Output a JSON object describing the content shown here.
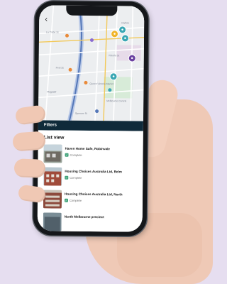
{
  "map": {
    "labels": [
      {
        "text": "La Trobe St",
        "name": "map-label-la-trobe"
      },
      {
        "text": "Victoria St",
        "name": "map-label-victoria"
      },
      {
        "text": "Peel St",
        "name": "map-label-peel"
      },
      {
        "text": "Queen Victoria Market",
        "name": "map-label-qvm"
      },
      {
        "text": "Melbourne Central",
        "name": "map-label-melb-central"
      },
      {
        "text": "Carlton",
        "name": "map-label-carlton"
      },
      {
        "text": "Flagstaff",
        "name": "map-label-flagstaff"
      },
      {
        "text": "Spencer St",
        "name": "map-label-spencer"
      }
    ],
    "pin_colors": {
      "teal": "#3aa7b3",
      "yellow": "#f0b429",
      "purple": "#6b3fa0"
    }
  },
  "panel": {
    "filters_label": "Filters",
    "list_title": "List view"
  },
  "items": [
    {
      "title": "Haven Home Safe, Robinvale",
      "status": "Complete"
    },
    {
      "title": "Housing Choices Australia Ltd, Belm",
      "status": "Complete"
    },
    {
      "title": "Housing Choices Australia Ltd, North",
      "status": "Complete"
    },
    {
      "title": "North Melbourne precinct",
      "status": ""
    }
  ],
  "colors": {
    "header_bar": "#0f2a3a",
    "status_check": "#41a37a",
    "background": "#e6def0"
  }
}
